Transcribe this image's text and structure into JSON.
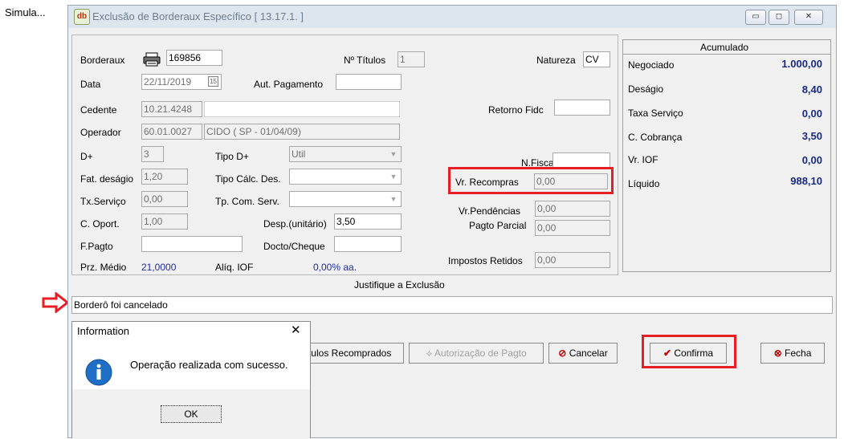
{
  "side_label": "Simula...",
  "window": {
    "title": "Exclusão de Borderaux Específico [ 13.17.1. ]",
    "icon_text": "db",
    "controls": {
      "minimize": "▭",
      "maximize": "◻",
      "close": "✕"
    }
  },
  "form": {
    "borderaux": {
      "label": "Borderaux",
      "value": "169856"
    },
    "num_titulos": {
      "label": "Nº Títulos",
      "value": "1"
    },
    "natureza": {
      "label": "Natureza",
      "value": "CV"
    },
    "data": {
      "label": "Data",
      "value": "22/11/2019",
      "cal_btn": "15"
    },
    "aut_pagamento": {
      "label": "Aut. Pagamento",
      "value": ""
    },
    "cedente": {
      "label": "Cedente",
      "code": "10.21.4248"
    },
    "retorno_fidc": {
      "label": "Retorno Fidc",
      "value": ""
    },
    "operador": {
      "label": "Operador",
      "code": "60.01.0027",
      "name": "CIDO  ( SP - 01/04/09)"
    },
    "d_plus": {
      "label": "D+",
      "value": "3"
    },
    "tipo_d_plus": {
      "label": "Tipo D+",
      "value": "Util"
    },
    "n_fiscal": {
      "label": "N.Fiscal",
      "value": ""
    },
    "fat_desagio": {
      "label": "Fat. deságio",
      "value": "1,20"
    },
    "tipo_calc_des": {
      "label": "Tipo Cálc. Des.",
      "value": ""
    },
    "vr_recompras": {
      "label": "Vr. Recompras",
      "value": "0,00"
    },
    "tx_servico": {
      "label": "Tx.Serviço",
      "value": "0,00"
    },
    "tp_com_serv": {
      "label": "Tp. Com. Serv.",
      "value": ""
    },
    "vr_pendencias": {
      "label": "Vr.Pendências",
      "value": "0,00"
    },
    "c_oport": {
      "label": "C. Oport.",
      "value": "1,00"
    },
    "desp_unitario": {
      "label": "Desp.(unitário)",
      "value": "3,50"
    },
    "pagto_parcial": {
      "label": "Pagto Parcial",
      "value": "0,00"
    },
    "f_pagto": {
      "label": "F.Pagto",
      "value": ""
    },
    "docto_cheque": {
      "label": "Docto/Cheque",
      "value": ""
    },
    "impostos_retidos": {
      "label": "Impostos Retidos",
      "value": "0,00"
    },
    "prz_medio": {
      "label": "Prz. Médio",
      "value": "21,0000"
    },
    "aliq_iof": {
      "label": "Alíq. IOF",
      "value": "0,00% aa."
    }
  },
  "acumulado": {
    "title": "Acumulado",
    "rows": [
      {
        "label": "Negociado",
        "value": "1.000,00"
      },
      {
        "label": "Deságio",
        "value": "8,40"
      },
      {
        "label": "Taxa Serviço",
        "value": "0,00"
      },
      {
        "label": "C. Cobrança",
        "value": "3,50"
      },
      {
        "label": "Vr. IOF",
        "value": "0,00"
      },
      {
        "label": "Líquido",
        "value": "988,10"
      }
    ]
  },
  "justification": {
    "label": "Justifique a Exclusão",
    "value": "Borderô foi cancelado"
  },
  "buttons": {
    "titulos_recomprados": "ítulos Recomprados",
    "autorizacao_pagto": "Autorização de Pagto",
    "cancelar": "Cancelar",
    "confirma": "Confirma",
    "fecha": "Fecha"
  },
  "dialog": {
    "title": "Information",
    "close": "✕",
    "message": "Operação realizada com sucesso.",
    "ok": "OK"
  },
  "colors": {
    "highlight": "#e81e25",
    "accent_blue": "#1f2ea0"
  }
}
